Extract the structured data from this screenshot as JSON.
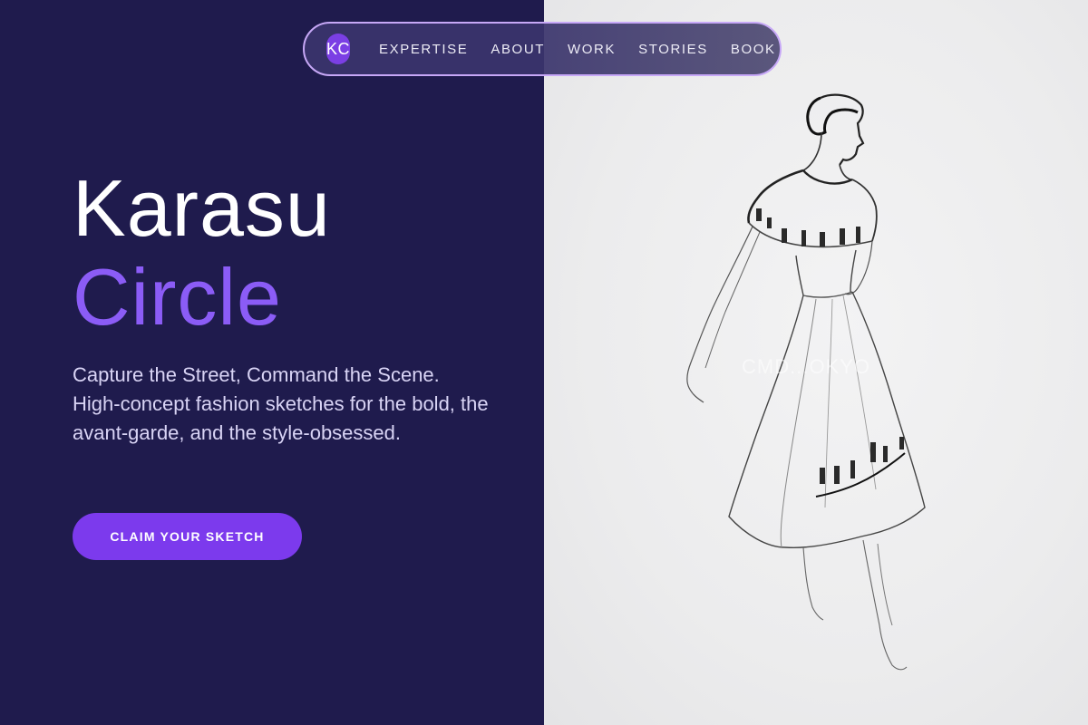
{
  "nav": {
    "logo": "KC",
    "items": [
      "EXPERTISE",
      "ABOUT",
      "WORK",
      "STORIES",
      "BOOK"
    ]
  },
  "hero": {
    "title_line1": "Karasu",
    "title_line2": "Circle",
    "tagline": "Capture the Street, Command the Scene. High-concept fashion sketches for the bold, the avant-garde, and the style-obsessed.",
    "cta_label": "CLAIM YOUR SKETCH"
  },
  "image": {
    "subject": "fashion-sketch-dress",
    "watermark": "CMD...OKYO"
  },
  "colors": {
    "background_dark": "#1f1b4d",
    "accent_purple": "#8b5cf6",
    "button_purple": "#7c3aed",
    "nav_border": "#c7a8f7",
    "text_light": "#d9d4f5"
  }
}
